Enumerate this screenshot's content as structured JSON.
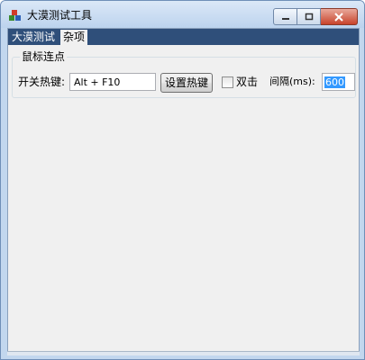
{
  "window": {
    "title": "大漠测试工具"
  },
  "tabs": [
    {
      "label": "大漠测试"
    },
    {
      "label": "杂项"
    }
  ],
  "group": {
    "title": "鼠标连点",
    "hotkey_label": "开关热键:",
    "hotkey_value": "Alt + F10",
    "set_hotkey_button": "设置热键",
    "double_click_label": "双击",
    "double_click_checked": false,
    "interval_label": "间隔(ms):",
    "interval_value": "600"
  },
  "icons": {
    "app": "app-icon",
    "minimize": "minimize-icon",
    "maximize": "maximize-icon",
    "close": "close-icon"
  },
  "colors": {
    "tabbar": "#2f4f7a",
    "selection": "#3399ff",
    "close_button": "#c8432b"
  }
}
